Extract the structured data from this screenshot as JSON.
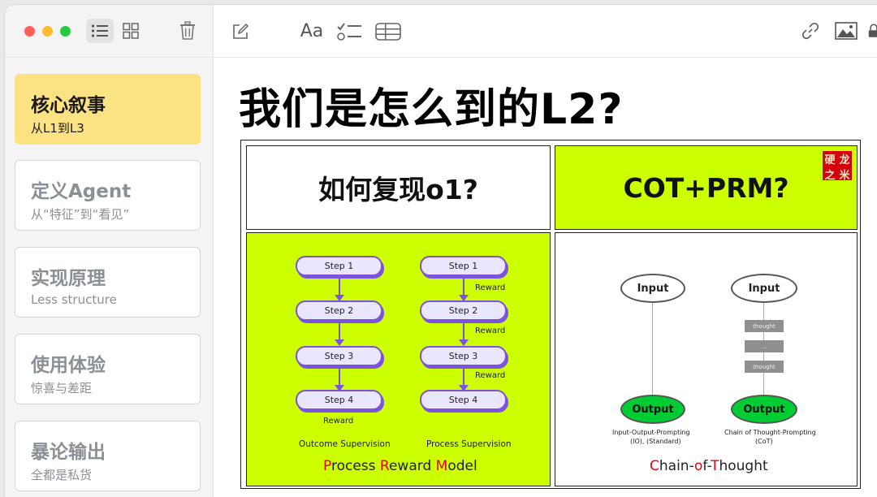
{
  "colors": {
    "close": "#ff5f57",
    "minimize": "#febc2e",
    "maximize": "#28c840",
    "active_note": "#fde283",
    "lime": "#ccff00",
    "purple": "#7d53de",
    "output_green": "#00cc33",
    "stamp_red": "#d4000a"
  },
  "toolbar": {
    "icons": [
      "list-view-icon",
      "gallery-view-icon",
      "trash-icon",
      "compose-icon",
      "format-text-icon",
      "checklist-icon",
      "table-icon",
      "link-icon",
      "media-icon",
      "lock-icon"
    ],
    "format_label": "Aa"
  },
  "notes": [
    {
      "title": "核心叙事",
      "subtitle": "从L1到L3"
    },
    {
      "title": "定义Agent",
      "subtitle": "从“特征”到“看见”"
    },
    {
      "title": "实现原理",
      "subtitle": "Less structure"
    },
    {
      "title": "使用体验",
      "subtitle": "惊喜与差距"
    },
    {
      "title": "暴论输出",
      "subtitle": "全都是私货"
    }
  ],
  "document": {
    "title": "我们是怎么到的L2?",
    "panel_left_title": "如何复现o1?",
    "panel_right_title": "COT+PRM?",
    "stamp_chars": [
      "硬",
      "龙",
      "之",
      "米"
    ],
    "prm": {
      "steps_left": [
        "Step 1",
        "Step 2",
        "Step 3",
        "Step 4"
      ],
      "steps_right": [
        "Step 1",
        "Step 2",
        "Step 3",
        "Step 4"
      ],
      "reward": "Reward",
      "outcome_label": "Outcome Supervision",
      "process_label": "Process Supervision",
      "caption": {
        "p1": "P",
        "p2": "rocess ",
        "p3": "R",
        "p4": "eward ",
        "p5": "M",
        "p6": "odel"
      }
    },
    "cot": {
      "input": "Input",
      "output": "Output",
      "thought": "thought",
      "dots": "...",
      "io_label_1": "Input-Output-Prompting",
      "io_label_2": "(IO), (Standard)",
      "cot_label_1": "Chain of Thought-Prompting",
      "cot_label_2": "(CoT)",
      "caption": {
        "c1": "C",
        "c2": "hain-",
        "c3": "o",
        "c4": "f-",
        "c5": "T",
        "c6": "hought"
      }
    }
  }
}
